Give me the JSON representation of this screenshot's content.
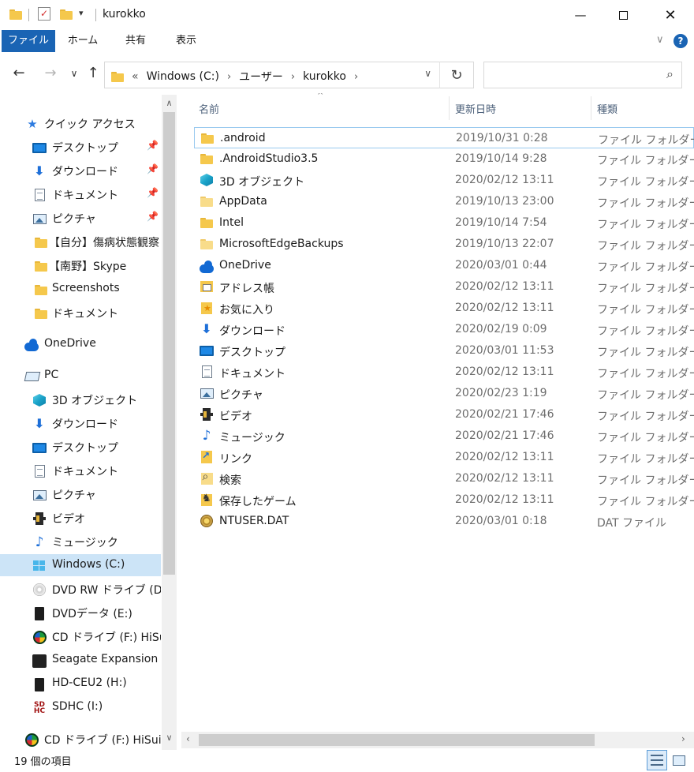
{
  "window": {
    "title": "kurokko"
  },
  "ribbon": {
    "tabs": [
      {
        "label": "ファイル"
      },
      {
        "label": "ホーム"
      },
      {
        "label": "共有"
      },
      {
        "label": "表示"
      }
    ]
  },
  "address": {
    "overflow": "«",
    "crumbs": [
      "Windows (C:)",
      "ユーザー",
      "kurokko"
    ],
    "search_placeholder": ""
  },
  "nav": {
    "quick_access": "クイック アクセス",
    "items": [
      {
        "label": "クイック アクセス",
        "icon": "star-icon"
      },
      {
        "label": "デスクトップ",
        "icon": "monitor-icon",
        "pinned": true
      },
      {
        "label": "ダウンロード",
        "icon": "download-icon",
        "pinned": true
      },
      {
        "label": "ドキュメント",
        "icon": "document-icon",
        "pinned": true
      },
      {
        "label": "ピクチャ",
        "icon": "picture-icon",
        "pinned": true
      },
      {
        "label": "【自分】傷病状態観察",
        "icon": "folder-icon"
      },
      {
        "label": "【南野】Skype",
        "icon": "folder-icon"
      },
      {
        "label": "Screenshots",
        "icon": "folder-icon"
      },
      {
        "label": "ドキュメント",
        "icon": "folder-icon"
      },
      {
        "label": "OneDrive",
        "icon": "cloud-icon"
      },
      {
        "label": "PC",
        "icon": "pc-icon"
      },
      {
        "label": "3D オブジェクト",
        "icon": "cube-icon"
      },
      {
        "label": "ダウンロード",
        "icon": "download-icon"
      },
      {
        "label": "デスクトップ",
        "icon": "monitor-icon"
      },
      {
        "label": "ドキュメント",
        "icon": "document-icon"
      },
      {
        "label": "ピクチャ",
        "icon": "picture-icon"
      },
      {
        "label": "ビデオ",
        "icon": "film-icon"
      },
      {
        "label": "ミュージック",
        "icon": "music-icon"
      },
      {
        "label": "Windows (C:)",
        "icon": "windows-drive-icon",
        "selected": true
      },
      {
        "label": "DVD RW ドライブ (D:) ...",
        "icon": "disc-icon"
      },
      {
        "label": "DVDデータ (E:)",
        "icon": "drive-icon"
      },
      {
        "label": "CD ドライブ (F:) HiSuite",
        "icon": "hisuite-icon"
      },
      {
        "label": "Seagate Expansion Dri",
        "icon": "seagate-icon"
      },
      {
        "label": "HD-CEU2 (H:)",
        "icon": "drive-icon"
      },
      {
        "label": "SDHC (I:)",
        "icon": "sd-icon"
      },
      {
        "label": "CD ドライブ (F:) HiSuite",
        "icon": "hisuite-icon"
      }
    ]
  },
  "columns": {
    "name": "名前",
    "date": "更新日時",
    "type": "種類"
  },
  "files": [
    {
      "name": ".android",
      "date": "2019/10/31 0:28",
      "type": "ファイル フォルダー",
      "icon": "folder-icon"
    },
    {
      "name": ".AndroidStudio3.5",
      "date": "2019/10/14 9:28",
      "type": "ファイル フォルダー",
      "icon": "folder-icon"
    },
    {
      "name": "3D オブジェクト",
      "date": "2020/02/12 13:11",
      "type": "ファイル フォルダー",
      "icon": "cube-icon"
    },
    {
      "name": "AppData",
      "date": "2019/10/13 23:00",
      "type": "ファイル フォルダー",
      "icon": "folder-pale-icon"
    },
    {
      "name": "Intel",
      "date": "2019/10/14 7:54",
      "type": "ファイル フォルダー",
      "icon": "folder-icon"
    },
    {
      "name": "MicrosoftEdgeBackups",
      "date": "2019/10/13 22:07",
      "type": "ファイル フォルダー",
      "icon": "folder-pale-icon"
    },
    {
      "name": "OneDrive",
      "date": "2020/03/01 0:44",
      "type": "ファイル フォルダー",
      "icon": "cloud-icon"
    },
    {
      "name": "アドレス帳",
      "date": "2020/02/12 13:11",
      "type": "ファイル フォルダー",
      "icon": "contacts-icon"
    },
    {
      "name": "お気に入り",
      "date": "2020/02/12 13:11",
      "type": "ファイル フォルダー",
      "icon": "favorites-icon"
    },
    {
      "name": "ダウンロード",
      "date": "2020/02/19 0:09",
      "type": "ファイル フォルダー",
      "icon": "download-icon"
    },
    {
      "name": "デスクトップ",
      "date": "2020/03/01 11:53",
      "type": "ファイル フォルダー",
      "icon": "monitor-icon"
    },
    {
      "name": "ドキュメント",
      "date": "2020/02/12 13:11",
      "type": "ファイル フォルダー",
      "icon": "document-icon"
    },
    {
      "name": "ピクチャ",
      "date": "2020/02/23 1:19",
      "type": "ファイル フォルダー",
      "icon": "picture-icon"
    },
    {
      "name": "ビデオ",
      "date": "2020/02/21 17:46",
      "type": "ファイル フォルダー",
      "icon": "film-icon"
    },
    {
      "name": "ミュージック",
      "date": "2020/02/21 17:46",
      "type": "ファイル フォルダー",
      "icon": "music-icon"
    },
    {
      "name": "リンク",
      "date": "2020/02/12 13:11",
      "type": "ファイル フォルダー",
      "icon": "link-icon"
    },
    {
      "name": "検索",
      "date": "2020/02/12 13:11",
      "type": "ファイル フォルダー",
      "icon": "search-folder-icon"
    },
    {
      "name": "保存したゲーム",
      "date": "2020/02/12 13:11",
      "type": "ファイル フォルダー",
      "icon": "saved-games-icon"
    },
    {
      "name": "NTUSER.DAT",
      "date": "2020/03/01 0:18",
      "type": "DAT ファイル",
      "icon": "dat-file-icon"
    }
  ],
  "status": {
    "item_count": "19 個の項目"
  },
  "colors": {
    "accent": "#1a64b4",
    "selection": "#cce4f7",
    "folder": "#f5c84c"
  }
}
